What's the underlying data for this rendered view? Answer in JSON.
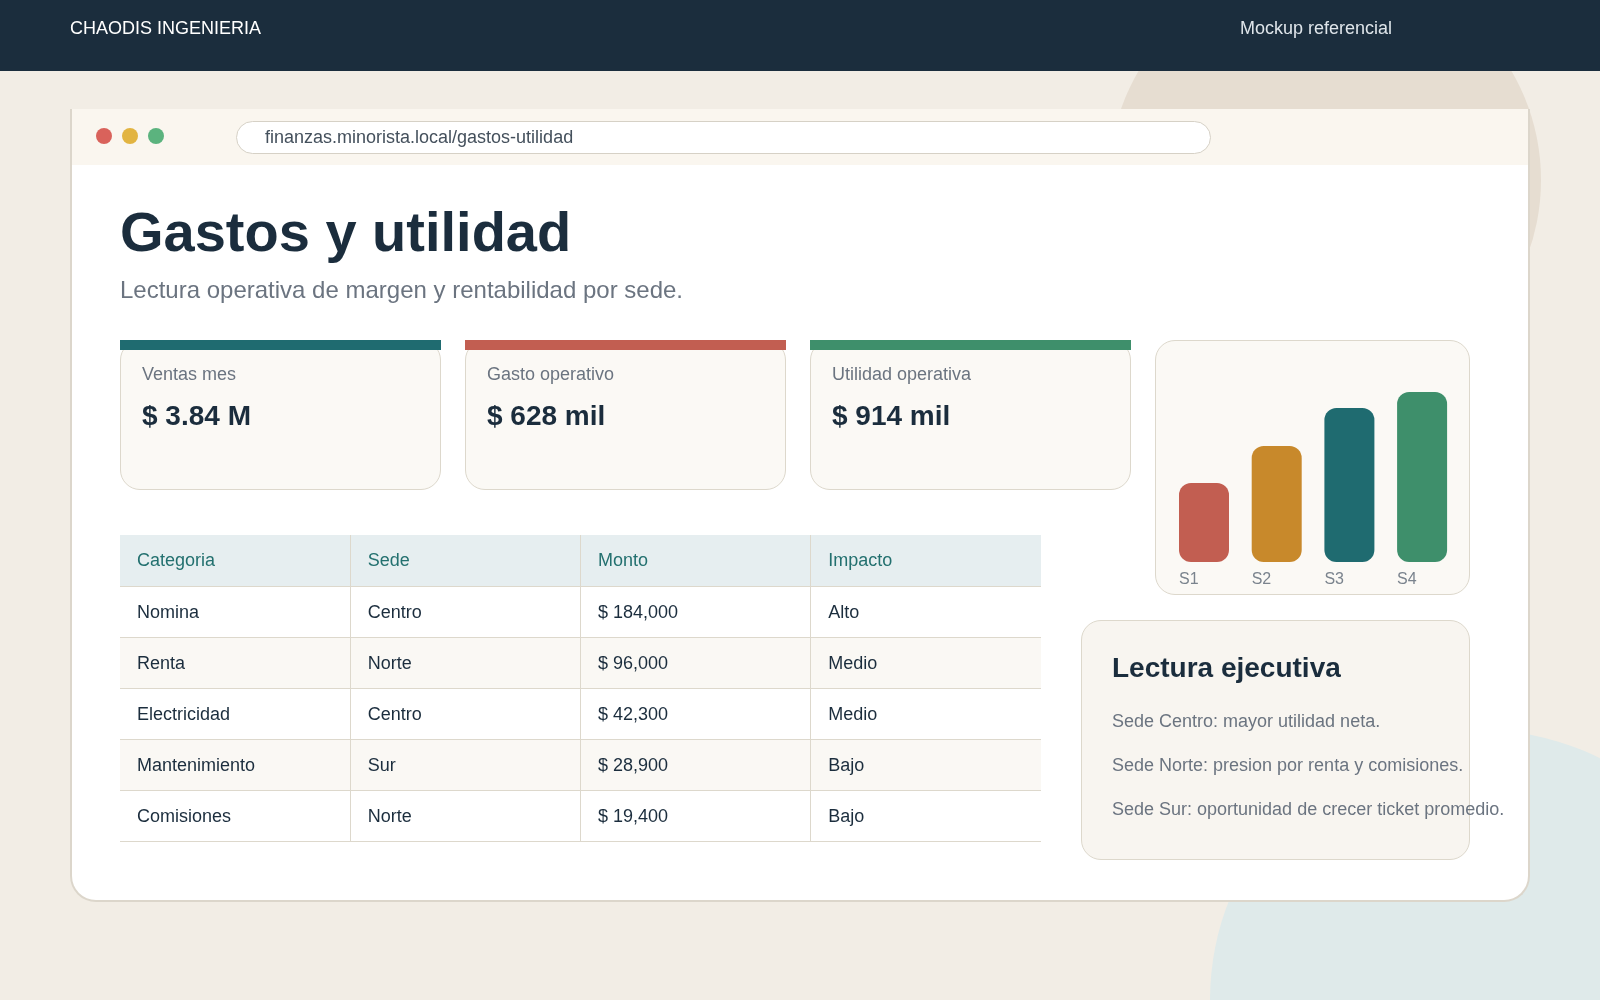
{
  "top_bar": {
    "brand": "CHAODIS INGENIERIA",
    "note": "Mockup referencial"
  },
  "browser": {
    "url": "finanzas.minorista.local/gastos-utilidad"
  },
  "page": {
    "title": "Gastos y utilidad",
    "subtitle": "Lectura operativa de margen y rentabilidad por sede."
  },
  "kpis": [
    {
      "label": "Ventas mes",
      "value": "$ 3.84 M",
      "color": "#1f6b70"
    },
    {
      "label": "Gasto operativo",
      "value": "$ 628 mil",
      "color": "#c25e51"
    },
    {
      "label": "Utilidad operativa",
      "value": "$ 914 mil",
      "color": "#3e8f6b"
    }
  ],
  "chart": {
    "bars": [
      {
        "label": "S1",
        "color": "#c25e51"
      },
      {
        "label": "S2",
        "color": "#c8892b"
      },
      {
        "label": "S3",
        "color": "#1f6b70"
      },
      {
        "label": "S4",
        "color": "#3e8f6b"
      }
    ]
  },
  "table": {
    "columns": [
      "Categoria",
      "Sede",
      "Monto",
      "Impacto"
    ],
    "rows": [
      [
        "Nomina",
        "Centro",
        "$ 184,000",
        "Alto"
      ],
      [
        "Renta",
        "Norte",
        "$ 96,000",
        "Medio"
      ],
      [
        "Electricidad",
        "Centro",
        "$ 42,300",
        "Medio"
      ],
      [
        "Mantenimiento",
        "Sur",
        "$ 28,900",
        "Bajo"
      ],
      [
        "Comisiones",
        "Norte",
        "$ 19,400",
        "Bajo"
      ]
    ]
  },
  "summary": {
    "title": "Lectura ejecutiva",
    "lines": [
      "Sede Centro: mayor utilidad neta.",
      "Sede Norte: presion por renta y comisiones.",
      "Sede Sur: oportunidad de crecer ticket promedio."
    ]
  }
}
